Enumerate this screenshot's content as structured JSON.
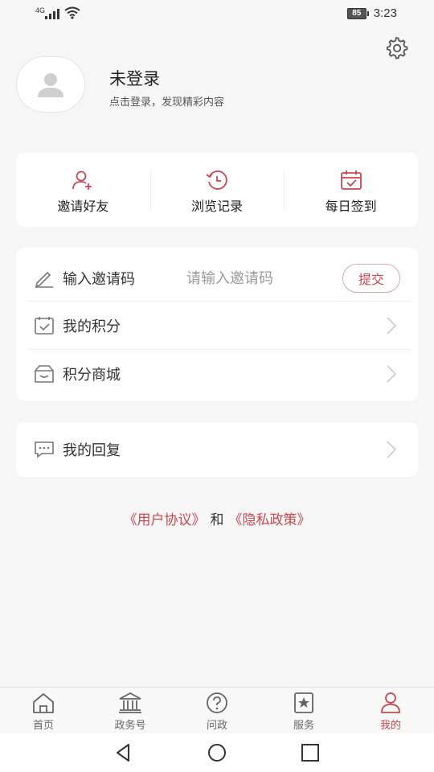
{
  "status_bar": {
    "network": "4G",
    "battery": "85",
    "time": "3:23"
  },
  "profile": {
    "title": "未登录",
    "subtitle": "点击登录，发现精彩内容"
  },
  "quick_actions": [
    {
      "label": "邀请好友",
      "icon": "add-user-icon"
    },
    {
      "label": "浏览记录",
      "icon": "history-icon"
    },
    {
      "label": "每日签到",
      "icon": "calendar-check-icon"
    }
  ],
  "menu": {
    "invite": {
      "label": "输入邀请码",
      "placeholder": "请输入邀请码",
      "submit_label": "提交"
    },
    "points": {
      "label": "我的积分"
    },
    "mall": {
      "label": "积分商城"
    },
    "reply": {
      "label": "我的回复"
    }
  },
  "legal": {
    "user_agreement": "《用户协议》",
    "and": "和",
    "privacy_policy": "《隐私政策》"
  },
  "tabs": [
    {
      "label": "首页",
      "icon": "home-icon"
    },
    {
      "label": "政务号",
      "icon": "government-icon"
    },
    {
      "label": "问政",
      "icon": "question-icon"
    },
    {
      "label": "服务",
      "icon": "service-star-icon"
    },
    {
      "label": "我的",
      "icon": "user-icon",
      "active": true
    }
  ],
  "colors": {
    "accent": "#c9474f",
    "background": "#f6f6f6"
  }
}
